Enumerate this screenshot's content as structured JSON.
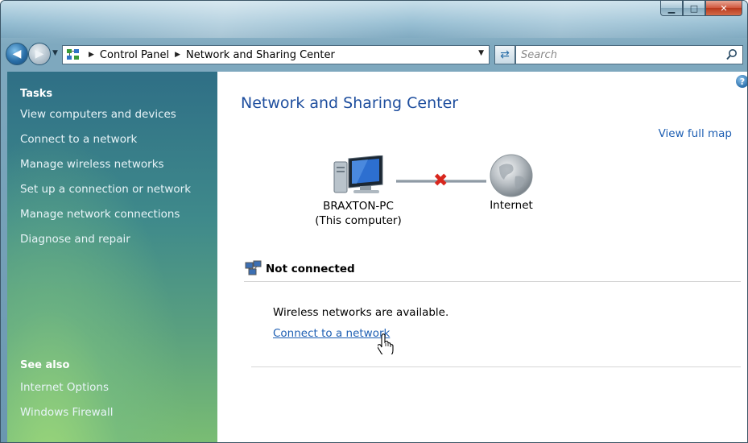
{
  "window": {
    "minimize_glyph": "▁",
    "maximize_glyph": "□",
    "close_glyph": "✕"
  },
  "address_bar": {
    "breadcrumbs": [
      "Control Panel",
      "Network and Sharing Center"
    ],
    "search_placeholder": "Search"
  },
  "sidebar": {
    "tasks_heading": "Tasks",
    "tasks": [
      "View computers and devices",
      "Connect to a network",
      "Manage wireless networks",
      "Set up a connection or network",
      "Manage network connections",
      "Diagnose and repair"
    ],
    "see_also_heading": "See also",
    "see_also": [
      "Internet Options",
      "Windows Firewall"
    ]
  },
  "main": {
    "title": "Network and Sharing Center",
    "view_full_map": "View full map",
    "computer_name": "BRAXTON-PC",
    "computer_sub": "(This computer)",
    "internet_label": "Internet",
    "status": "Not connected",
    "wireless_message": "Wireless networks are available.",
    "connect_link": "Connect to a network"
  },
  "colors": {
    "link": "#1e5fb3",
    "title": "#1e4e9e",
    "disconnect_x": "#d8261d"
  }
}
